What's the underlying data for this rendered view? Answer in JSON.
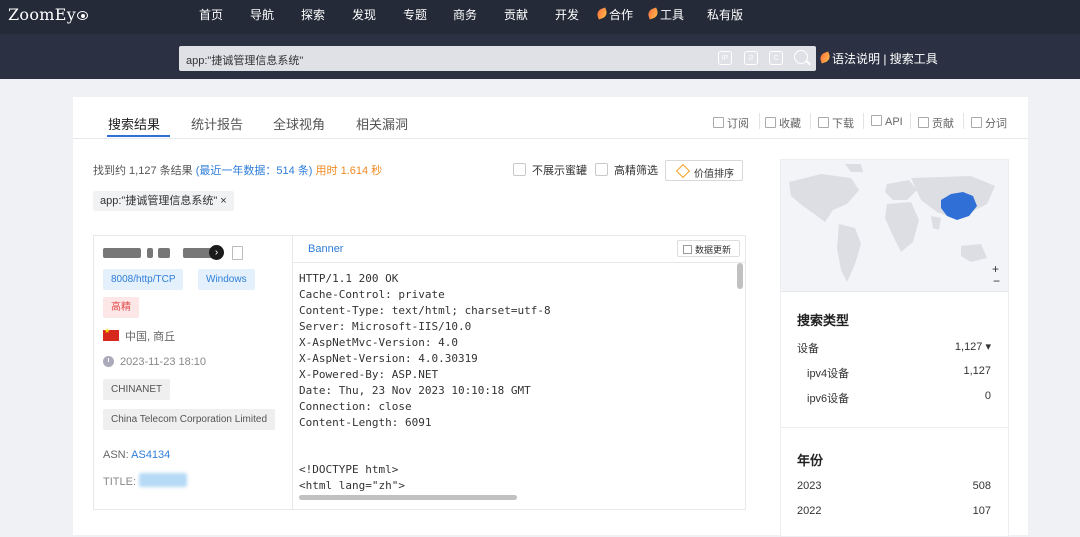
{
  "logo": "ZoomEy",
  "nav": [
    "首页",
    "导航",
    "探索",
    "发现",
    "专题",
    "商务",
    "贡献",
    "开发",
    "合作",
    "工具",
    "私有版"
  ],
  "search": {
    "query": "app:\"捷诚管理信息系统\"",
    "icons": [
      "IP",
      "ㄹ",
      "C"
    ]
  },
  "syntax_links": "语法说明 | 搜索工具",
  "tabs": [
    "搜索结果",
    "统计报告",
    "全球视角",
    "相关漏洞"
  ],
  "actions": [
    "订阅",
    "收藏",
    "下载",
    "API",
    "贡献",
    "分词"
  ],
  "summary": {
    "prefix": "找到约 1,127 条结果",
    "year": "(最近一年数据：514 条)",
    "time": "用时 1.614 秒"
  },
  "filters": {
    "honeypot": "不展示蜜罐",
    "precise": "高精筛选",
    "sort": "价值排序"
  },
  "query_tag": "app:\"捷诚管理信息系统\" ×",
  "result": {
    "tags": [
      "8008/http/TCP",
      "Windows",
      "高精"
    ],
    "location": "中国, 商丘",
    "datetime": "2023-11-23 18:10",
    "isp": "CHINANET",
    "org": "China Telecom Corporation Limited",
    "asn_label": "ASN:",
    "asn": "AS4134",
    "title_label": "TITLE:",
    "banner_label": "Banner",
    "update_label": "数据更新",
    "banner_lines": [
      "HTTP/1.1 200 OK",
      "Cache-Control: private",
      "Content-Type: text/html; charset=utf-8",
      "Server: Microsoft-IIS/10.0",
      "X-AspNetMvc-Version: 4.0",
      "X-AspNet-Version: 4.0.30319",
      "X-Powered-By: ASP.NET",
      "Date: Thu, 23 Nov 2023 10:10:18 GMT",
      "Connection: close",
      "Content-Length: 6091",
      "",
      "",
      "<!DOCTYPE html>",
      "<html lang=\"zh\">"
    ]
  },
  "stats": {
    "search_type_title": "搜索类型",
    "device_label": "设备",
    "device_count": "1,127 ▾",
    "ipv4_label": "ipv4设备",
    "ipv4_count": "1,127",
    "ipv6_label": "ipv6设备",
    "ipv6_count": "0",
    "year_title": "年份",
    "years": [
      {
        "year": "2023",
        "count": "508"
      },
      {
        "year": "2022",
        "count": "107"
      }
    ]
  },
  "colors": {
    "accent": "#2f7ed8",
    "topbar": "#2b3142",
    "highlight_country": "#2f6fd6"
  }
}
